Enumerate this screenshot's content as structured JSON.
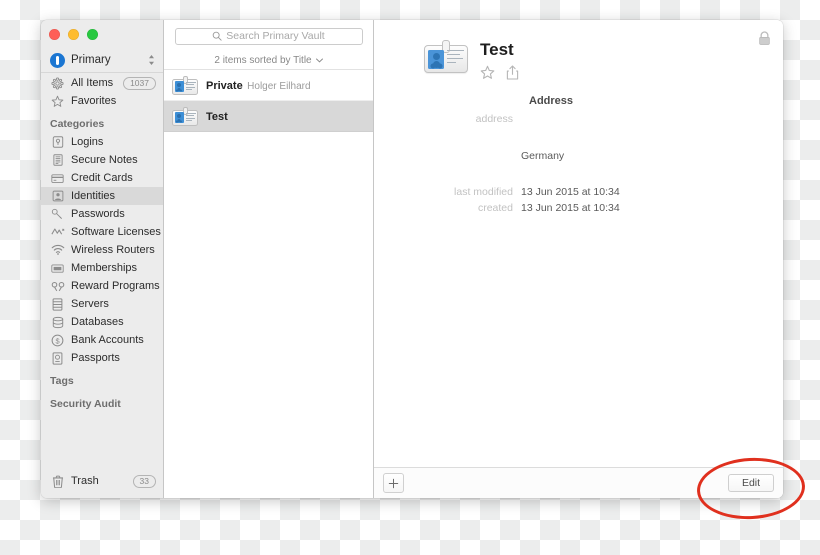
{
  "window": {
    "traffic_lights": [
      "close",
      "minimize",
      "zoom"
    ],
    "lock_icon": "lock-icon"
  },
  "sidebar": {
    "vault": {
      "name": "Primary",
      "icon": "vault-badge-icon",
      "stepper_icon": "up-down-chevron-icon"
    },
    "top_items": [
      {
        "label": "All Items",
        "icon": "all-items-icon",
        "count": "1037"
      },
      {
        "label": "Favorites",
        "icon": "star-icon",
        "count": ""
      }
    ],
    "categories_header": "Categories",
    "categories": [
      {
        "label": "Logins",
        "icon": "login-icon",
        "selected": false
      },
      {
        "label": "Secure Notes",
        "icon": "note-icon",
        "selected": false
      },
      {
        "label": "Credit Cards",
        "icon": "credit-card-icon",
        "selected": false
      },
      {
        "label": "Identities",
        "icon": "identity-icon",
        "selected": true
      },
      {
        "label": "Passwords",
        "icon": "key-icon",
        "selected": false
      },
      {
        "label": "Software Licenses",
        "icon": "license-icon",
        "selected": false
      },
      {
        "label": "Wireless Routers",
        "icon": "wifi-icon",
        "selected": false
      },
      {
        "label": "Memberships",
        "icon": "membership-icon",
        "selected": false
      },
      {
        "label": "Reward Programs",
        "icon": "reward-icon",
        "selected": false
      },
      {
        "label": "Servers",
        "icon": "server-icon",
        "selected": false
      },
      {
        "label": "Databases",
        "icon": "database-icon",
        "selected": false
      },
      {
        "label": "Bank Accounts",
        "icon": "bank-icon",
        "selected": false
      },
      {
        "label": "Passports",
        "icon": "passport-icon",
        "selected": false
      }
    ],
    "tags_header": "Tags",
    "security_audit_header": "Security Audit",
    "trash": {
      "label": "Trash",
      "icon": "trash-icon",
      "count": "33"
    }
  },
  "list": {
    "search": {
      "placeholder": "Search Primary Vault",
      "icon": "search-icon"
    },
    "sort_bar": {
      "text": "2 items sorted by Title",
      "caret_icon": "chevron-down-icon"
    },
    "items": [
      {
        "title": "Private",
        "subtitle": "Holger Eilhard",
        "icon": "identity-card-icon",
        "selected": false
      },
      {
        "title": "Test",
        "subtitle": "",
        "icon": "identity-card-icon",
        "selected": true
      }
    ]
  },
  "detail": {
    "icon": "identity-card-icon",
    "title": "Test",
    "actions": [
      {
        "name": "favorite-star-icon"
      },
      {
        "name": "share-icon"
      }
    ],
    "section_title": "Address",
    "fields": [
      {
        "label": "address",
        "value": ""
      },
      {
        "label": "",
        "value": "Germany"
      }
    ],
    "meta": [
      {
        "label": "last modified",
        "value": "13 Jun 2015 at 10:34"
      },
      {
        "label": "created",
        "value": "13 Jun 2015 at 10:34"
      }
    ]
  },
  "bottom_bar": {
    "add_label": "+",
    "edit_label": "Edit"
  },
  "annotation": {
    "shape": "ellipse",
    "color": "#e0301e",
    "target": "Edit"
  }
}
